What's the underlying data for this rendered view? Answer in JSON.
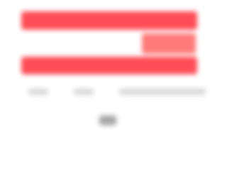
{
  "colors": {
    "stripe_red": "#ff4d57",
    "stripe_accent": "#ff7a7a",
    "caption_gray": "#d8d8d8",
    "mark_gray": "#a8a8a8"
  },
  "flag": {
    "stripes": [
      "red",
      "white",
      "red"
    ]
  },
  "caption": {
    "segments": [
      "",
      "",
      ""
    ]
  },
  "bottom_mark": {
    "text": ""
  }
}
